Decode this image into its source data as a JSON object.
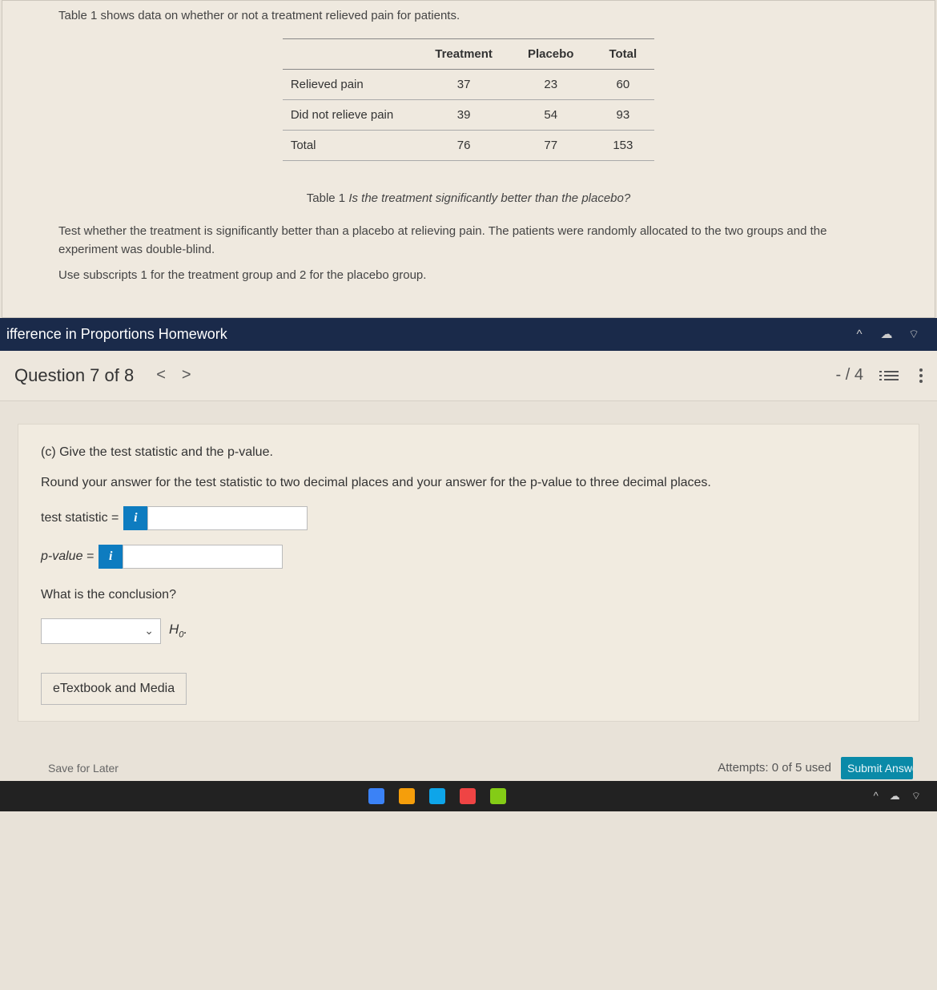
{
  "top": {
    "intro": "Table 1 shows data on whether or not a treatment relieved pain for patients.",
    "table": {
      "headers": [
        "",
        "Treatment",
        "Placebo",
        "Total"
      ],
      "rows": [
        [
          "Relieved pain",
          "37",
          "23",
          "60"
        ],
        [
          "Did not relieve pain",
          "39",
          "54",
          "93"
        ],
        [
          "Total",
          "76",
          "77",
          "153"
        ]
      ]
    },
    "caption_lead": "Table 1 ",
    "caption_ital": "Is the treatment significantly better than the placebo?",
    "para1": "Test whether the treatment is significantly better than a placebo at relieving pain. The patients were randomly allocated to the two groups and the experiment was double-blind.",
    "para2": "Use subscripts 1 for the treatment group and 2 for the placebo group."
  },
  "bar": {
    "title": "ifference in Proportions Homework"
  },
  "question": {
    "label": "Question 7 of 8",
    "prev": "<",
    "next": ">",
    "score": "- / 4"
  },
  "panel": {
    "part": "(c) Give the test statistic and the p-value.",
    "instr": "Round your answer for the test statistic to two decimal places and your answer for the p-value to three decimal places.",
    "stat_label": "test statistic  =",
    "pval_label": "p-value  =",
    "info": "i",
    "concl_q": "What is the conclusion?",
    "select_caret": "⌄",
    "h0_base": "H",
    "h0_sub": "0",
    "h0_dot": ".",
    "etext": "eTextbook and Media"
  },
  "footer": {
    "save": "Save for Later",
    "attempts": "Attempts: 0 of 5 used",
    "submit": "Submit Answer"
  }
}
